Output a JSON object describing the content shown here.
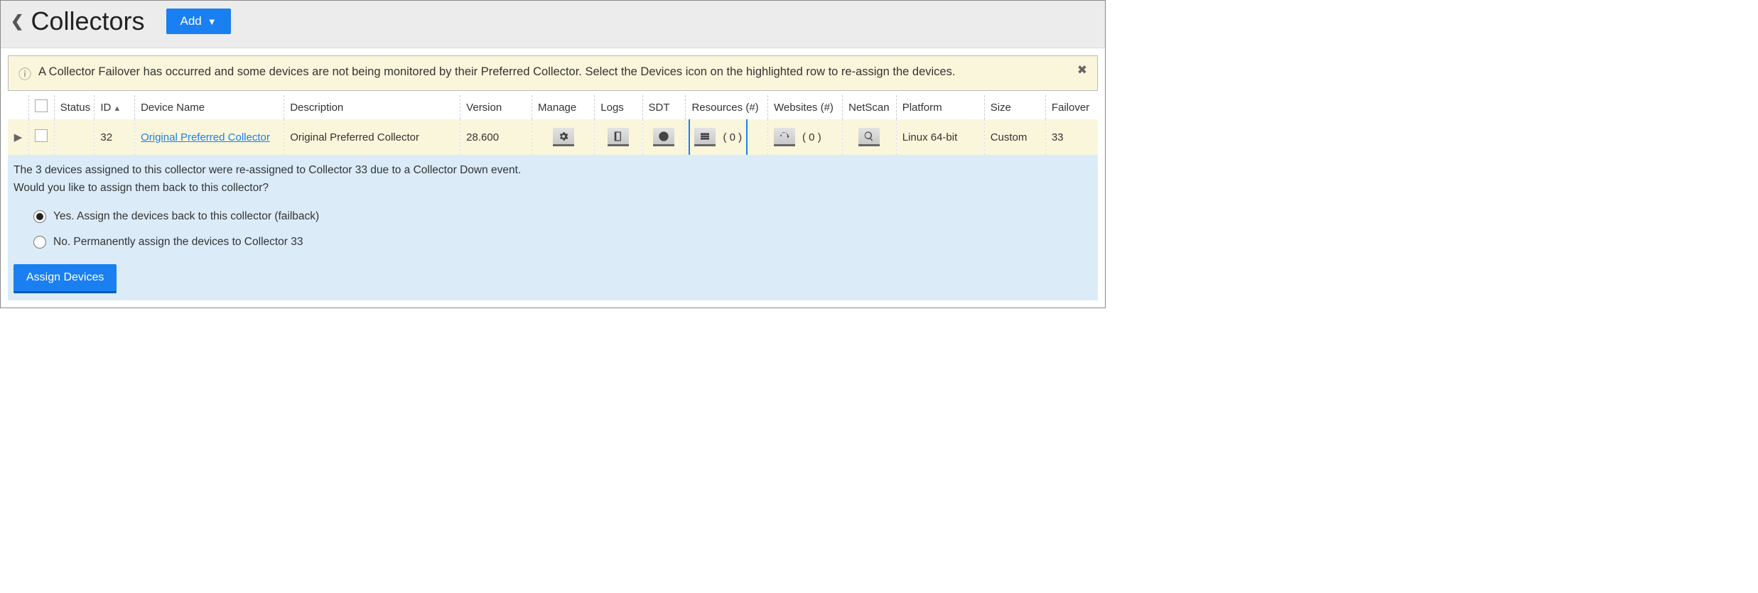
{
  "header": {
    "title": "Collectors",
    "add_label": "Add"
  },
  "alert": {
    "message": "A Collector Failover has occurred and some devices are not being monitored by their Preferred Collector. Select the Devices icon on the highlighted row to re-assign the devices."
  },
  "table": {
    "headers": {
      "status": "Status",
      "id": "ID",
      "device_name": "Device Name",
      "description": "Description",
      "version": "Version",
      "manage": "Manage",
      "logs": "Logs",
      "sdt": "SDT",
      "resources": "Resources (#)",
      "websites": "Websites (#)",
      "netscan": "NetScan",
      "platform": "Platform",
      "size": "Size",
      "failover": "Failover"
    },
    "rows": [
      {
        "id": "32",
        "device_name": "Original Preferred Collector",
        "description": "Original Preferred Collector",
        "version": "28.600",
        "resources_count": "( 0 )",
        "websites_count": "( 0 )",
        "platform": "Linux 64-bit",
        "size": "Custom",
        "failover": "33"
      }
    ]
  },
  "detail": {
    "line1": "The 3 devices assigned to this collector were re-assigned to Collector 33 due to a Collector Down event.",
    "line2": "Would you like to assign them back to this collector?",
    "option_yes": "Yes. Assign the devices back to this collector (failback)",
    "option_no": "No. Permanently assign the devices to Collector 33",
    "assign_label": "Assign Devices"
  }
}
